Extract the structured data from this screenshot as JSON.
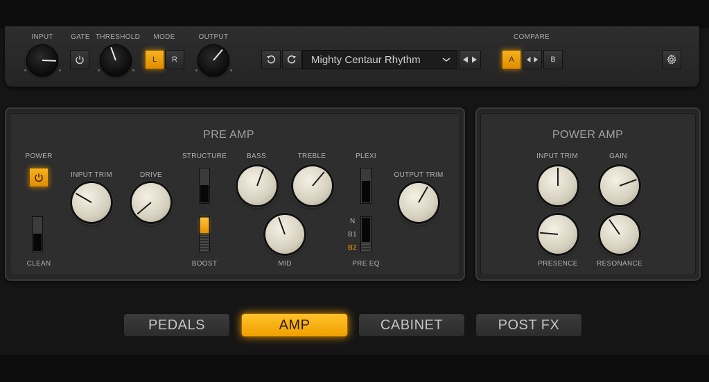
{
  "toolbar": {
    "input_label": "INPUT",
    "gate_label": "GATE",
    "threshold_label": "THRESHOLD",
    "mode_label": "MODE",
    "mode_l": "L",
    "mode_r": "R",
    "mode_active": "L",
    "output_label": "OUTPUT",
    "preset_name": "Mighty Centaur Rhythm",
    "compare_label": "COMPARE",
    "compare_a": "A",
    "compare_b": "B",
    "compare_active": "A",
    "icons": [
      "power-icon",
      "undo-icon",
      "redo-icon",
      "chevron-down-icon",
      "arrow-left-icon",
      "arrow-right-icon",
      "gear-icon"
    ]
  },
  "pre_amp": {
    "title": "PRE AMP",
    "power_label": "POWER",
    "power_on": true,
    "clean_label": "CLEAN",
    "input_trim_label": "INPUT TRIM",
    "drive_label": "DRIVE",
    "structure_label": "STRUCTURE",
    "boost_label": "BOOST",
    "bass_label": "BASS",
    "treble_label": "TREBLE",
    "mid_label": "MID",
    "plexi_label": "PLEXI",
    "pre_eq_label": "PRE EQ",
    "pre_eq_options": [
      "N",
      "B1",
      "B2"
    ],
    "pre_eq_selected": "B2",
    "output_trim_label": "OUTPUT TRIM"
  },
  "power_amp": {
    "title": "POWER AMP",
    "input_trim_label": "INPUT TRIM",
    "gain_label": "GAIN",
    "presence_label": "PRESENCE",
    "resonance_label": "RESONANCE"
  },
  "tabs": [
    "PEDALS",
    "AMP",
    "CABINET",
    "POST FX"
  ],
  "active_tab": "AMP",
  "colors": {
    "accent": "#f5a800",
    "panel": "#2b2b2b",
    "background": "#151515"
  }
}
